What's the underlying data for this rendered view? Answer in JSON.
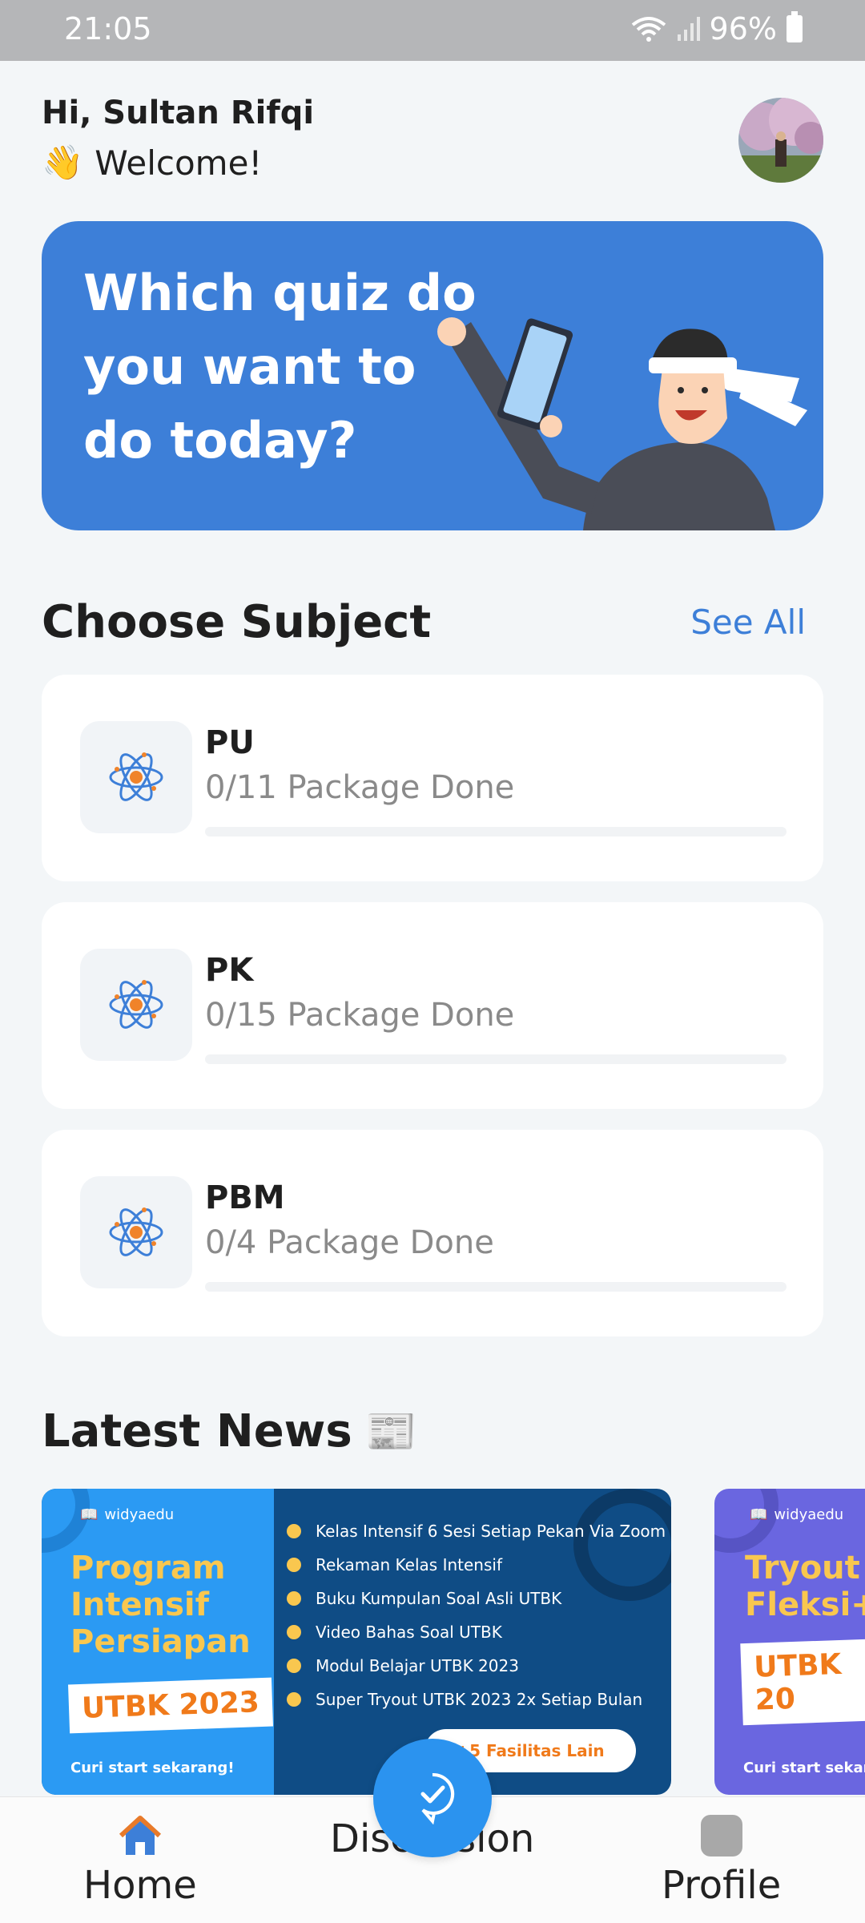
{
  "status_bar": {
    "time": "21:05",
    "battery": "96%"
  },
  "header": {
    "greeting": "Hi, Sultan Rifqi",
    "welcome": "Welcome!",
    "wave_emoji": "👋"
  },
  "banner": {
    "text": "Which quiz do you want to do today?"
  },
  "subjects": {
    "title": "Choose Subject",
    "see_all": "See All",
    "items": [
      {
        "name": "PU",
        "progress_text": "0/11 Package Done",
        "progress": 0
      },
      {
        "name": "PK",
        "progress_text": "0/15 Package Done",
        "progress": 0
      },
      {
        "name": "PBM",
        "progress_text": "0/4 Package Done",
        "progress": 0
      }
    ]
  },
  "news": {
    "title": "Latest News",
    "title_emoji": "📰",
    "cards": [
      {
        "brand": "widyaedu",
        "headline": [
          "Program",
          "Intensif",
          "Persiapan"
        ],
        "badge": "UTBK 2023",
        "cta": "Curi start sekarang!",
        "features": [
          "Kelas Intensif 6 Sesi Setiap Pekan Via Zoom",
          "Rekaman Kelas Intensif",
          "Buku Kumpulan Soal Asli UTBK",
          "Video Bahas Soal UTBK",
          "Modul Belajar UTBK 2023",
          "Super Tryout UTBK 2023 2x Setiap Bulan"
        ],
        "more": "+5 Fasilitas Lain"
      },
      {
        "brand": "widyaedu",
        "headline": [
          "Tryout",
          "Fleksi+"
        ],
        "badge": "UTBK 20",
        "cta": "Curi start sekaran"
      }
    ]
  },
  "bottom_nav": {
    "items": [
      {
        "label": "Home",
        "icon": "home-icon"
      },
      {
        "label": "Discussion",
        "icon": "discussion-icon"
      },
      {
        "label": "Profile",
        "icon": "profile-icon"
      }
    ]
  },
  "colors": {
    "accent": "#3d7fd8",
    "fab": "#2b93ef",
    "home_icon": "#e87a2a"
  }
}
